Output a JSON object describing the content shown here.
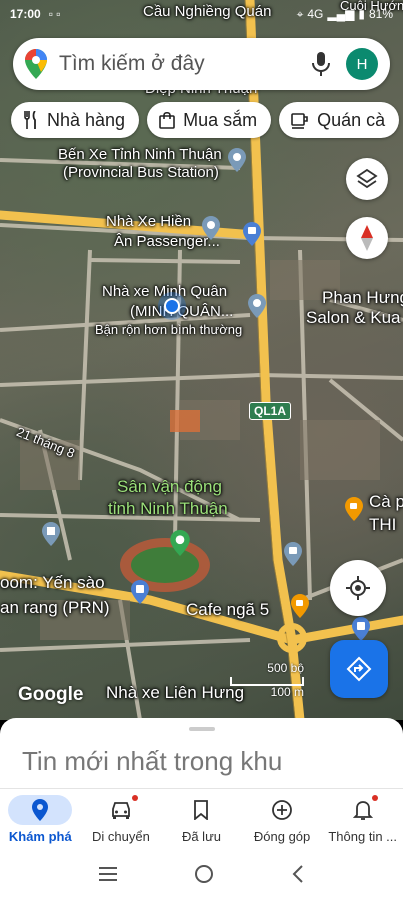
{
  "status_bar": {
    "time": "17:00",
    "network": "4G",
    "battery": "81%"
  },
  "search": {
    "placeholder": "Tìm kiếm ở đây",
    "avatar_initial": "H"
  },
  "chips": [
    {
      "label": "Nhà hàng",
      "icon": "fork-knife-icon"
    },
    {
      "label": "Mua sắm",
      "icon": "shopping-bag-icon"
    },
    {
      "label": "Quán cà",
      "icon": "coffee-icon"
    }
  ],
  "map": {
    "labels": {
      "top_road": "Cầu Nghiềng Quán",
      "top_right": "Cuội Hướng",
      "top_partial": "Diệp Ninh Thuận",
      "bus_station": "Bến Xe Tỉnh Ninh Thuận",
      "bus_station_en": "(Provincial Bus Station)",
      "nha_xe_hien": "Nhà Xe Hiền",
      "an_passenger": "Ân Passenger...",
      "minh_quan": "Nhà xe Minh Quân",
      "minh_quan_sub": "(MINH QUÂN...",
      "busy": "Bận rộn hơn bình thường",
      "phan_hung": "Phan Hưng",
      "salon": "Salon & Kua",
      "street_21": "21 tháng 8",
      "highway": "QL1A",
      "stadium_1": "Sân vận động",
      "stadium_2": "tỉnh Ninh Thuận",
      "ca_phe": "Cà p",
      "thi": "THI",
      "yen_sao": "oom: Yến sào",
      "prn": "an rang (PRN)",
      "cafe_nga5": "Cafe ngã 5",
      "lien_hung": "Nhà xe Liên Hưng"
    },
    "scale_top": "500 bộ",
    "scale_bottom": "100 m",
    "logo": "Google"
  },
  "sheet": {
    "title": "Tin mới nhất trong khu"
  },
  "nav": [
    {
      "label": "Khám phá",
      "icon": "explore-pin-icon",
      "active": true
    },
    {
      "label": "Di chuyển",
      "icon": "car-icon",
      "active": false
    },
    {
      "label": "Đã lưu",
      "icon": "bookmark-icon",
      "active": false
    },
    {
      "label": "Đóng góp",
      "icon": "add-circle-icon",
      "active": false
    },
    {
      "label": "Thông tin ...",
      "icon": "bell-icon",
      "active": false
    }
  ],
  "colors": {
    "accent": "#1a73e8",
    "active_tab_bg": "#d3e3fd",
    "road": "#f2c14e"
  }
}
